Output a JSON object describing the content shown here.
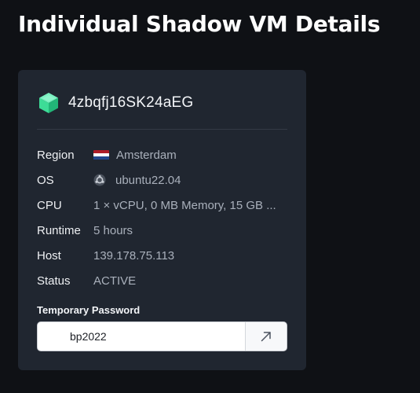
{
  "page": {
    "title": "Individual Shadow VM Details"
  },
  "vm": {
    "icon": "cube-icon",
    "name": "4zbqfj16SK24aEG",
    "accent_color": "#3ddc97",
    "details": [
      {
        "key": "region",
        "label": "Region",
        "value": "Amsterdam",
        "icon": "netherlands-flag-icon"
      },
      {
        "key": "os",
        "label": "OS",
        "value": "ubuntu22.04",
        "icon": "ubuntu-icon"
      },
      {
        "key": "cpu",
        "label": "CPU",
        "value": "1 × vCPU, 0 MB Memory, 15 GB ..."
      },
      {
        "key": "runtime",
        "label": "Runtime",
        "value": "5 hours"
      },
      {
        "key": "host",
        "label": "Host",
        "value": "139.178.75.113"
      },
      {
        "key": "status",
        "label": "Status",
        "value": "ACTIVE"
      }
    ]
  },
  "password": {
    "label": "Temporary Password",
    "value": "bp2022",
    "open_icon": "arrow-up-right-icon"
  },
  "colors": {
    "background": "#0f1115",
    "card": "#202630",
    "flag_red": "#ae1c28",
    "flag_white": "#ffffff",
    "flag_blue": "#21468b"
  }
}
